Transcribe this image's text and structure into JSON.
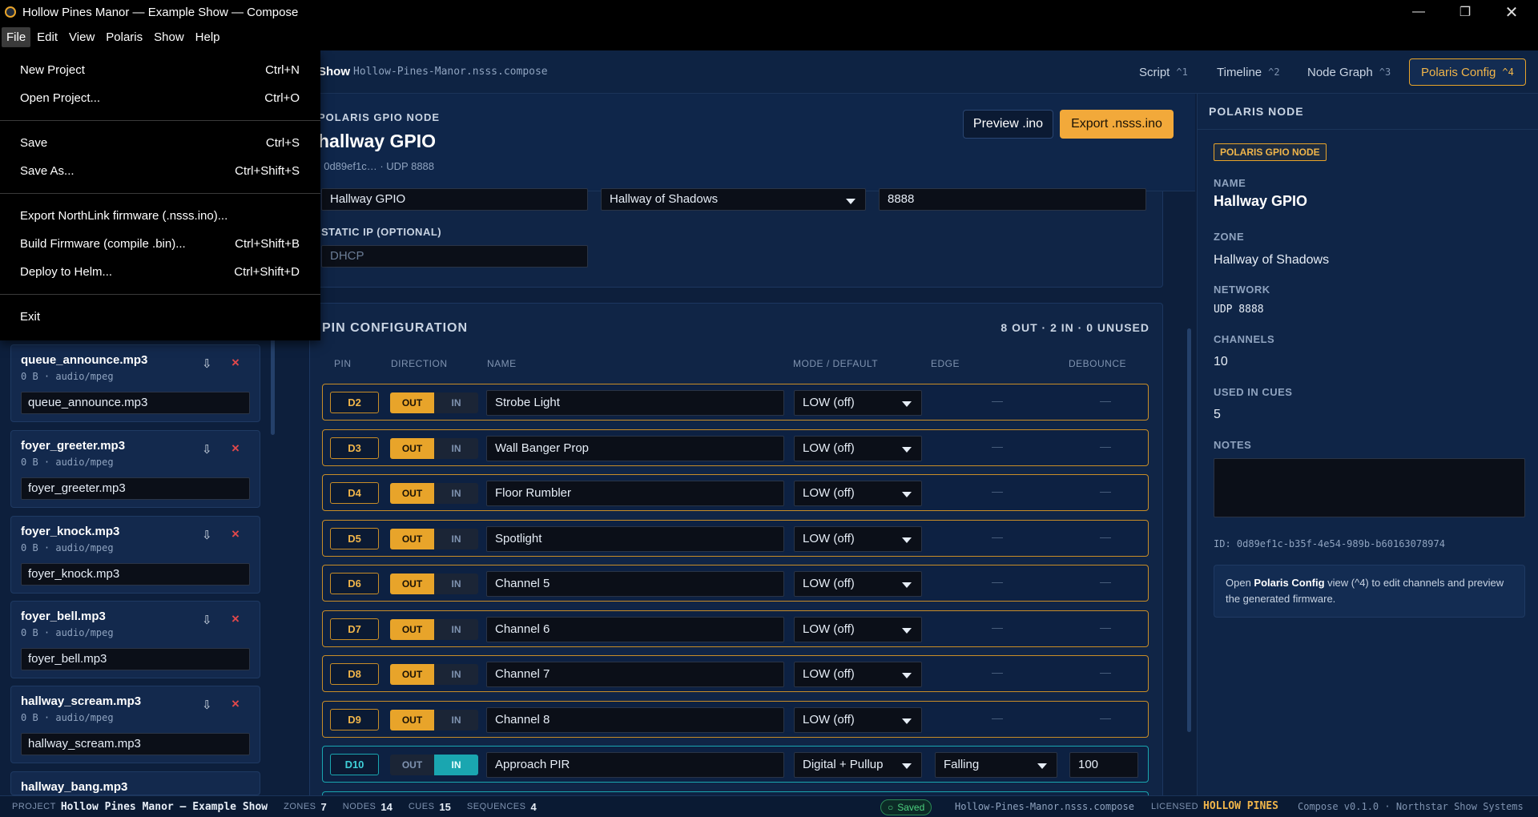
{
  "window": {
    "title": "Hollow Pines Manor — Example Show — Compose"
  },
  "menubar": {
    "items": [
      "File",
      "Edit",
      "View",
      "Polaris",
      "Show",
      "Help"
    ]
  },
  "file_menu": {
    "items": [
      {
        "label": "New Project",
        "shortcut": "Ctrl+N"
      },
      {
        "label": "Open Project...",
        "shortcut": "Ctrl+O"
      },
      {
        "label": "Save",
        "shortcut": "Ctrl+S"
      },
      {
        "label": "Save As...",
        "shortcut": "Ctrl+Shift+S"
      },
      {
        "label": "Export NorthLink firmware (.nsss.ino)...",
        "shortcut": ""
      },
      {
        "label": "Build Firmware (compile .bin)...",
        "shortcut": "Ctrl+Shift+B"
      },
      {
        "label": "Deploy to Helm...",
        "shortcut": "Ctrl+Shift+D"
      },
      {
        "label": "Exit",
        "shortcut": ""
      }
    ]
  },
  "view_header": {
    "show_label": "Show",
    "file_name": "Hollow-Pines-Manor.nsss.compose",
    "tabs": [
      {
        "label": "Script",
        "key": "^1"
      },
      {
        "label": "Timeline",
        "key": "^2"
      },
      {
        "label": "Node Graph",
        "key": "^3"
      },
      {
        "label": "Polaris Config",
        "key": "^4"
      }
    ]
  },
  "node": {
    "kind": "POLARIS GPIO NODE",
    "name": "hallway GPIO",
    "meta": ": 0d89ef1c… · UDP 8888",
    "preview_label": "Preview .ino",
    "export_label": "Export .nsss.ino",
    "name_value": "Hallway GPIO",
    "zone_value": "Hallway of Shadows",
    "port_value": "8888",
    "static_ip_label": "STATIC IP (OPTIONAL)",
    "static_ip_placeholder": "DHCP"
  },
  "pins": {
    "title": "PIN CONFIGURATION",
    "summary": "8 OUT · 2 IN · 0 UNUSED",
    "columns": [
      "PIN",
      "DIRECTION",
      "NAME",
      "MODE / DEFAULT",
      "EDGE",
      "DEBOUNCE"
    ],
    "dir_out": "OUT",
    "dir_in": "IN",
    "dash": "—",
    "rows": [
      {
        "pin": "D2",
        "dir": "out",
        "name": "Strobe Light",
        "mode": "LOW (off)"
      },
      {
        "pin": "D3",
        "dir": "out",
        "name": "Wall Banger Prop",
        "mode": "LOW (off)"
      },
      {
        "pin": "D4",
        "dir": "out",
        "name": "Floor Rumbler",
        "mode": "LOW (off)"
      },
      {
        "pin": "D5",
        "dir": "out",
        "name": "Spotlight",
        "mode": "LOW (off)"
      },
      {
        "pin": "D6",
        "dir": "out",
        "name": "Channel 5",
        "mode": "LOW (off)"
      },
      {
        "pin": "D7",
        "dir": "out",
        "name": "Channel 6",
        "mode": "LOW (off)"
      },
      {
        "pin": "D8",
        "dir": "out",
        "name": "Channel 7",
        "mode": "LOW (off)"
      },
      {
        "pin": "D9",
        "dir": "out",
        "name": "Channel 8",
        "mode": "LOW (off)"
      },
      {
        "pin": "D10",
        "dir": "in",
        "name": "Approach PIR",
        "mode": "Digital + Pullup",
        "edge": "Falling",
        "debounce": "100"
      }
    ]
  },
  "audio_files": [
    {
      "name": "queue_announce.mp3",
      "meta": "0 B · audio/mpeg",
      "value": "queue_announce.mp3"
    },
    {
      "name": "foyer_greeter.mp3",
      "meta": "0 B · audio/mpeg",
      "value": "foyer_greeter.mp3"
    },
    {
      "name": "foyer_knock.mp3",
      "meta": "0 B · audio/mpeg",
      "value": "foyer_knock.mp3"
    },
    {
      "name": "foyer_bell.mp3",
      "meta": "0 B · audio/mpeg",
      "value": "foyer_bell.mp3"
    },
    {
      "name": "hallway_scream.mp3",
      "meta": "0 B · audio/mpeg",
      "value": "hallway_scream.mp3"
    },
    {
      "name": "hallway_bang.mp3",
      "meta": "",
      "value": ""
    }
  ],
  "inspector": {
    "title": "POLARIS NODE",
    "badge": "POLARIS GPIO NODE",
    "name_label": "NAME",
    "name": "Hallway GPIO",
    "zone_label": "ZONE",
    "zone": "Hallway of Shadows",
    "network_label": "NETWORK",
    "network": "UDP 8888",
    "channels_label": "CHANNELS",
    "channels": "10",
    "used_label": "USED IN CUES",
    "used": "5",
    "notes_label": "NOTES",
    "id": "ID: 0d89ef1c-b35f-4e54-989b-b60163078974",
    "hint_pre": "Open ",
    "hint_bold": "Polaris Config",
    "hint_post": " view (^4) to edit channels and preview the generated firmware."
  },
  "status": {
    "project_label": "PROJECT",
    "project": "Hollow Pines Manor — Example Show",
    "zones_label": "ZONES",
    "zones": "7",
    "nodes_label": "NODES",
    "nodes": "14",
    "cues_label": "CUES",
    "cues": "15",
    "sequences_label": "SEQUENCES",
    "sequences": "4",
    "saved": "Saved",
    "file": "Hollow-Pines-Manor.nsss.compose",
    "licensed_label": "LICENSED",
    "licensed": "HOLLOW PINES",
    "version": "Compose v0.1.0 · Northstar Show Systems"
  },
  "colors": {
    "accent": "#e8a42a",
    "input_pin": "#1aa6b0",
    "bg": "#0d1f3c",
    "danger": "#e0484b",
    "ok": "#4cd07f"
  }
}
